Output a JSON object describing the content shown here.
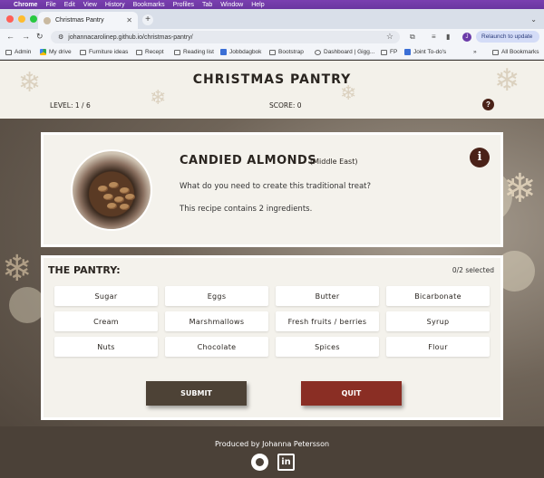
{
  "menubar": {
    "app": "Chrome",
    "items": [
      "File",
      "Edit",
      "View",
      "History",
      "Bookmarks",
      "Profiles",
      "Tab",
      "Window",
      "Help"
    ]
  },
  "browser": {
    "tab_title": "Christmas Pantry",
    "url": "johannacarolinep.github.io/christmas-pantry/",
    "profile_initial": "J",
    "relaunch_label": "Relaunch to update"
  },
  "bookmarks": [
    "Admin",
    "My drive",
    "Furniture ideas",
    "Recept",
    "Reading list",
    "Jobbdagbok",
    "Bootstrap",
    "Dashboard | Gigg...",
    "FP",
    "Joint To-do's",
    "All Bookmarks"
  ],
  "game": {
    "title": "CHRISTMAS PANTRY",
    "level_label": "LEVEL: 1 / 6",
    "score_label": "SCORE: 0",
    "help_icon_text": "?"
  },
  "recipe": {
    "name": "CANDIED ALMONDS",
    "region": "(Middle East)",
    "question": "What do you need to create this traditional treat?",
    "ingredient_count_text": "This recipe contains 2 ingredients.",
    "info_icon_text": "i"
  },
  "pantry": {
    "title": "THE PANTRY:",
    "selected_text": "0/2 selected",
    "ingredients": [
      "Sugar",
      "Eggs",
      "Butter",
      "Bicarbonate",
      "Cream",
      "Marshmallows",
      "Fresh fruits / berries",
      "Syrup",
      "Nuts",
      "Chocolate",
      "Spices",
      "Flour"
    ],
    "submit_label": "SUBMIT",
    "quit_label": "QUIT"
  },
  "footer": {
    "produced_by": "Produced by Johanna Petersson",
    "linkedin_text": "in"
  },
  "colors": {
    "menubar": "#6a36a0",
    "accent_dark": "#4a2218",
    "submit": "#4d4236",
    "quit": "#8a2e24",
    "footer": "#4b4138"
  }
}
